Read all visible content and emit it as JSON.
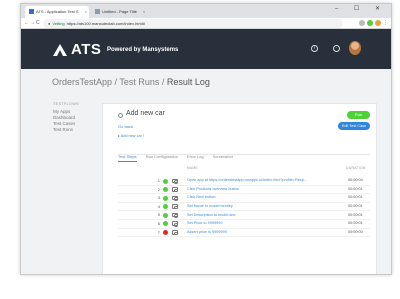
{
  "browser": {
    "tabs": [
      {
        "label": "ATS - Application Test S",
        "close": "×"
      },
      {
        "label": "Untitled - Page Title",
        "close": "×"
      }
    ],
    "window_controls": "–  ☐  ✕",
    "url": {
      "secure_label": "Vetting",
      "path": "https://ats100.mansuteolab.com/index.html#"
    }
  },
  "header": {
    "logo": "ATS",
    "subtitle": "Powered by Mansystems",
    "icons": [
      "info-icon",
      "settings-icon"
    ]
  },
  "page": {
    "title_prefix": "OrdersTestApp / Test Runs / ",
    "title_current": "Result Log"
  },
  "sidebar": {
    "section_label": "TESTFLOWS",
    "items": [
      {
        "label": "My Apps"
      },
      {
        "label": "Dashboard"
      },
      {
        "label": "Test Cases"
      },
      {
        "label": "Test Runs"
      }
    ]
  },
  "testcase": {
    "title": "Add new car",
    "go_back": "Go back",
    "test_run_link": "▸ Add new car /",
    "run_button": "Run",
    "edit_button": "Edit Test Case"
  },
  "tabs": [
    {
      "label": "Test Steps",
      "active": true
    },
    {
      "label": "Run Configuration",
      "active": false
    },
    {
      "label": "Error Log",
      "active": false
    },
    {
      "label": "Screenshot",
      "active": false
    }
  ],
  "table": {
    "headers": {
      "name": "NAME",
      "duration": "DURATION"
    },
    "rows": [
      {
        "num": "1",
        "status": "pass",
        "name": "Open app at https://orderstestapp.mxapps.io/index.html?profile=Resp...",
        "duration": "00:00:04"
      },
      {
        "num": "2",
        "status": "pass",
        "name": "Click Products overview button",
        "duration": "00:00:01"
      },
      {
        "num": "3",
        "status": "pass",
        "name": "Click New button",
        "duration": "00:00:01"
      },
      {
        "num": "4",
        "status": "pass",
        "name": "Set Name to model bentley",
        "duration": "00:00:01"
      },
      {
        "num": "5",
        "status": "pass",
        "name": "Set Description to model abc",
        "duration": "00:00:01"
      },
      {
        "num": "6",
        "status": "pass",
        "name": "Set Price to 9999999",
        "duration": "00:00:01"
      },
      {
        "num": "7",
        "status": "fail",
        "name": "Assert price is 9999999",
        "duration": "00:00:00"
      }
    ]
  },
  "colors": {
    "header_bg": "#27303b",
    "accent": "#3c8dd6",
    "pass": "#4cd137",
    "fail": "#e0262b",
    "run_button": "#4cd137",
    "edit_button": "#2e86de"
  }
}
